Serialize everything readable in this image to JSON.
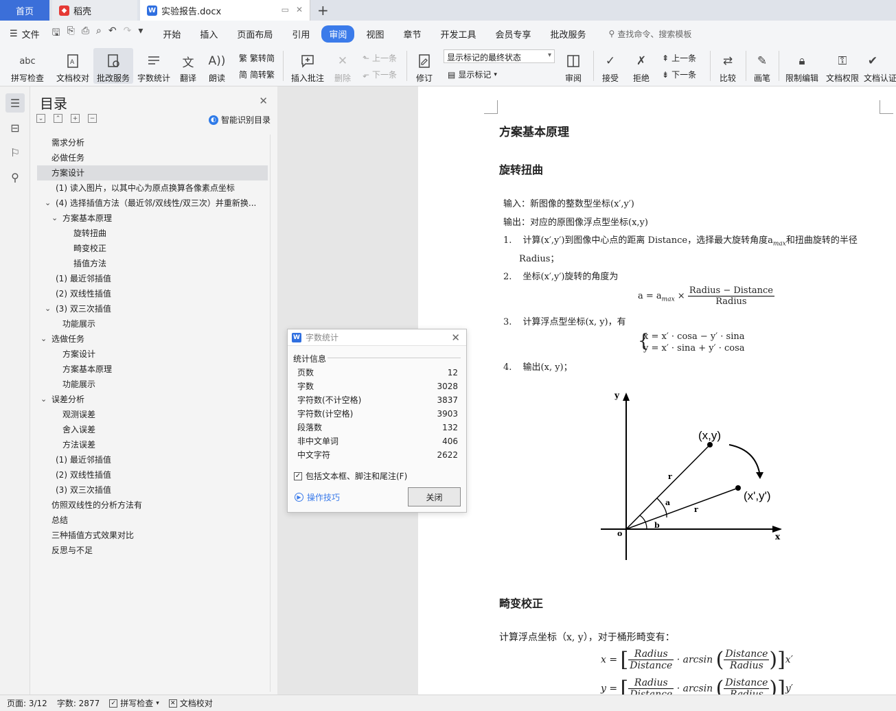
{
  "tabs": {
    "home": "首页",
    "daoke": "稻壳",
    "doc": "实验报告.docx"
  },
  "menu": {
    "file": "文件",
    "items": [
      "开始",
      "插入",
      "页面布局",
      "引用",
      "审阅",
      "视图",
      "章节",
      "开发工具",
      "会员专享",
      "批改服务"
    ],
    "active_index": 4,
    "search": "查找命令、搜索模板"
  },
  "ribbon": {
    "spell": "拼写检查",
    "proofread": "文档校对",
    "review_service": "批改服务",
    "wordcount": "字数统计",
    "translate": "翻译",
    "read": "朗读",
    "trad": "繁转简",
    "simp": "简转繁",
    "insert_comment": "插入批注",
    "delete": "删除",
    "prev": "上一条",
    "next": "下一条",
    "revise": "修订",
    "markup_state": "显示标记的最终状态",
    "show_markup": "显示标记",
    "review": "审阅",
    "accept": "接受",
    "reject": "拒绝",
    "prev2": "上一条",
    "next2": "下一条",
    "compare": "比较",
    "pen": "画笔",
    "restrict": "限制编辑",
    "perm": "文档权限",
    "cert": "文档认证"
  },
  "toc": {
    "title": "目录",
    "smart": "智能识别目录",
    "items": [
      {
        "text": "需求分析",
        "indent": 0,
        "arrow": false
      },
      {
        "text": "必做任务",
        "indent": 0,
        "arrow": false
      },
      {
        "text": "方案设计",
        "indent": 0,
        "arrow": false,
        "selected": true
      },
      {
        "text": "(1) 读入图片，以其中心为原点换算各像素点坐标",
        "indent": 1,
        "arrow": false
      },
      {
        "text": "(4) 选择插值方法（最近邻/双线性/双三次）并重新换...",
        "indent": 1,
        "arrow": true
      },
      {
        "text": "方案基本原理",
        "indent": 2,
        "arrow": true
      },
      {
        "text": "旋转扭曲",
        "indent": 3,
        "arrow": false
      },
      {
        "text": "畸变校正",
        "indent": 3,
        "arrow": false
      },
      {
        "text": "插值方法",
        "indent": 3,
        "arrow": false
      },
      {
        "text": "(1) 最近邻插值",
        "indent": 1,
        "arrow": false
      },
      {
        "text": "(2) 双线性插值",
        "indent": 1,
        "arrow": false
      },
      {
        "text": "(3) 双三次插值",
        "indent": 1,
        "arrow": true
      },
      {
        "text": "功能展示",
        "indent": 2,
        "arrow": false
      },
      {
        "text": "选做任务",
        "indent": 0,
        "arrow": true
      },
      {
        "text": "方案设计",
        "indent": 2,
        "arrow": false
      },
      {
        "text": "方案基本原理",
        "indent": 2,
        "arrow": false
      },
      {
        "text": "功能展示",
        "indent": 2,
        "arrow": false
      },
      {
        "text": "误差分析",
        "indent": 0,
        "arrow": true
      },
      {
        "text": "观测误差",
        "indent": 2,
        "arrow": false
      },
      {
        "text": "舍入误差",
        "indent": 2,
        "arrow": false
      },
      {
        "text": "方法误差",
        "indent": 2,
        "arrow": false
      },
      {
        "text": "(1) 最近邻插值",
        "indent": 1,
        "arrow": false
      },
      {
        "text": "(2) 双线性插值",
        "indent": 1,
        "arrow": false
      },
      {
        "text": "(3) 双三次插值",
        "indent": 1,
        "arrow": false
      },
      {
        "text": "仿照双线性的分析方法有",
        "indent": 0,
        "arrow": false
      },
      {
        "text": "总结",
        "indent": 0,
        "arrow": false
      },
      {
        "text": "三种插值方式效果对比",
        "indent": 0,
        "arrow": false
      },
      {
        "text": "反思与不足",
        "indent": 0,
        "arrow": false
      }
    ]
  },
  "doc": {
    "h1": "方案基本原理",
    "h2_rotate": "旋转扭曲",
    "input": "输入：新图像的整数型坐标(x′,y′)",
    "output": "输出：对应的原图像浮点型坐标(x,y)",
    "step1_num": "1.",
    "step1_a": "计算(x′,y′)到图像中心点的距离 Distance，选择最大旋转角度a",
    "step1_sub": "max",
    "step1_b": "和扭曲旋转的半径",
    "step1_c": "Radius；",
    "step2_num": "2.",
    "step2": "坐标(x′,y′)旋转的角度为",
    "f1_left": "a = a",
    "f1_sub": "max",
    "f1_times": " × ",
    "f1_num": "Radius − Distance",
    "f1_den": "Radius",
    "step3_num": "3.",
    "step3": "计算浮点型坐标(x, y)，有",
    "f2_line1": "x = x′ · cosa − y′ · sina",
    "f2_line2": "y = x′ · sina + y′ · cosa",
    "step4_num": "4.",
    "step4": "输出(x, y)；",
    "fig": {
      "y_axis": "y",
      "x_axis": "x",
      "origin": "o",
      "p1": "(x,y)",
      "p2": "(x',y')",
      "r": "r",
      "a": "a",
      "b": "b"
    },
    "h2_distort": "畸变校正",
    "distort_text": "计算浮点坐标（x, y），对于桶形畸变有：",
    "f3_x": "x =",
    "f3_y": "y =",
    "f3_num1": "Radius",
    "f3_den1": "Distance",
    "f3_arc": "· arcsin",
    "f3_num2": "Distance",
    "f3_den2": "Radius",
    "f3_tail_x": "x′",
    "f3_tail_y": "y′"
  },
  "dialog": {
    "title": "字数统计",
    "section": "统计信息",
    "rows": [
      {
        "label": "页数",
        "value": "12"
      },
      {
        "label": "字数",
        "value": "3028"
      },
      {
        "label": "字符数(不计空格)",
        "value": "3837"
      },
      {
        "label": "字符数(计空格)",
        "value": "3903"
      },
      {
        "label": "段落数",
        "value": "132"
      },
      {
        "label": "非中文单词",
        "value": "406"
      },
      {
        "label": "中文字符",
        "value": "2622"
      }
    ],
    "include": "包括文本框、脚注和尾注(F)",
    "tips": "操作技巧",
    "close": "关闭"
  },
  "status": {
    "page": "页面: 3/12",
    "words": "字数: 2877",
    "spell": "拼写检查",
    "proof": "文档校对"
  },
  "colors": {
    "accent": "#3b7bea",
    "home_tab": "#3b6fd9"
  }
}
